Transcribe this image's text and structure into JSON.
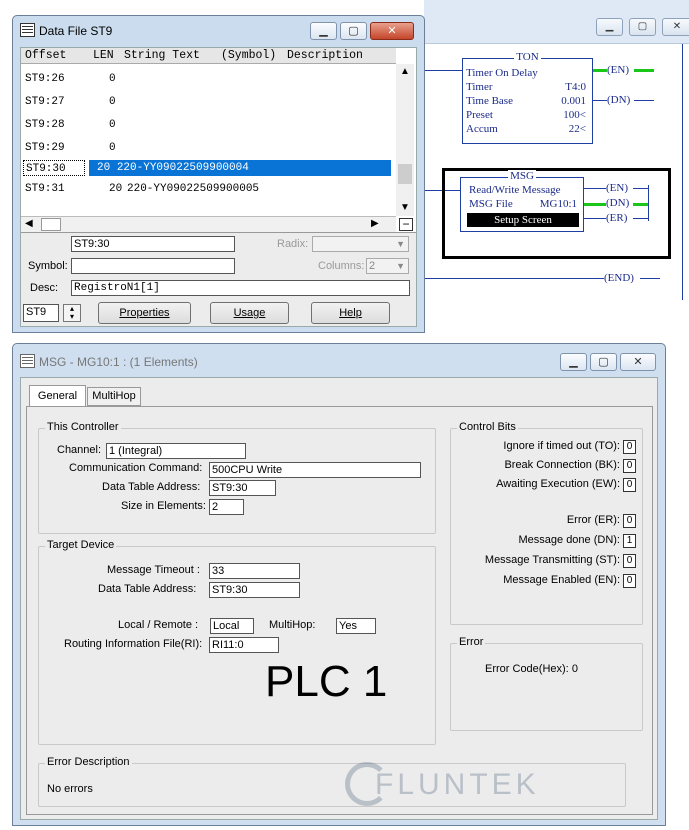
{
  "ladder": {
    "ton": {
      "title": "TON",
      "name": "Timer On Delay",
      "timer_lbl": "Timer",
      "timer_val": "T4:0",
      "timebase_lbl": "Time Base",
      "timebase_val": "0.001",
      "preset_lbl": "Preset",
      "preset_val": "100<",
      "accum_lbl": "Accum",
      "accum_val": "22<",
      "en": "EN",
      "dn": "DN"
    },
    "msg": {
      "title": "MSG",
      "name": "Read/Write Message",
      "file_lbl": "MSG File",
      "file_val": "MG10:1",
      "setup": "Setup Screen",
      "en": "EN",
      "dn": "DN",
      "er": "ER"
    },
    "end": "END"
  },
  "datafile": {
    "title": "Data File ST9",
    "headers": [
      "Offset",
      "LEN",
      "String Text",
      "(Symbol)",
      "Description"
    ],
    "rows": [
      {
        "offset": "ST9:26",
        "len": "0",
        "text": ""
      },
      {
        "offset": "ST9:27",
        "len": "0",
        "text": ""
      },
      {
        "offset": "ST9:28",
        "len": "0",
        "text": ""
      },
      {
        "offset": "ST9:29",
        "len": "0",
        "text": ""
      },
      {
        "offset": "ST9:30",
        "len": "20",
        "text": "220-YY09022509900004"
      },
      {
        "offset": "ST9:31",
        "len": "20",
        "text": "220-YY09022509900005"
      }
    ],
    "address": "ST9:30",
    "radix_lbl": "Radix:",
    "symbol_lbl": "Symbol:",
    "columns_lbl": "Columns:",
    "columns_val": "2",
    "desc_lbl": "Desc:",
    "desc_val": "RegistroN1[1]",
    "file_sel": "ST9",
    "btn_properties": "Properties",
    "btn_usage": "Usage",
    "btn_help": "Help"
  },
  "msg": {
    "title": "MSG - MG10:1 : (1 Elements)",
    "tab_general": "General",
    "tab_multihop": "MultiHop",
    "this_controller": "This Controller",
    "channel_lbl": "Channel:",
    "channel_val": "1 (Integral)",
    "comm_lbl": "Communication Command:",
    "comm_val": "500CPU Write",
    "dta_lbl": "Data Table Address:",
    "dta_val": "ST9:30",
    "size_lbl": "Size in Elements:",
    "size_val": "2",
    "target_device": "Target Device",
    "timeout_lbl": "Message Timeout :",
    "timeout_val": "33",
    "tdta_lbl": "Data Table Address:",
    "tdta_val": "ST9:30",
    "local_lbl": "Local / Remote :",
    "local_val": "Local",
    "multihop_lbl": "MultiHop:",
    "multihop_val": "Yes",
    "routing_lbl": "Routing Information File(RI):",
    "routing_val": "RI11:0",
    "plc_text": "PLC 1",
    "control_bits": "Control Bits",
    "bits": [
      {
        "label": "Ignore if timed out (TO):",
        "val": "0"
      },
      {
        "label": "Break Connection (BK):",
        "val": "0"
      },
      {
        "label": "Awaiting Execution (EW):",
        "val": "0"
      },
      {
        "label": "Error (ER):",
        "val": "0"
      },
      {
        "label": "Message done (DN):",
        "val": "1"
      },
      {
        "label": "Message Transmitting (ST):",
        "val": "0"
      },
      {
        "label": "Message Enabled (EN):",
        "val": "0"
      }
    ],
    "error_grp": "Error",
    "error_code_lbl": "Error Code(Hex):",
    "error_code_val": "0",
    "error_desc_grp": "Error Description",
    "error_desc_val": "No errors",
    "watermark": "FLUNTEK"
  }
}
